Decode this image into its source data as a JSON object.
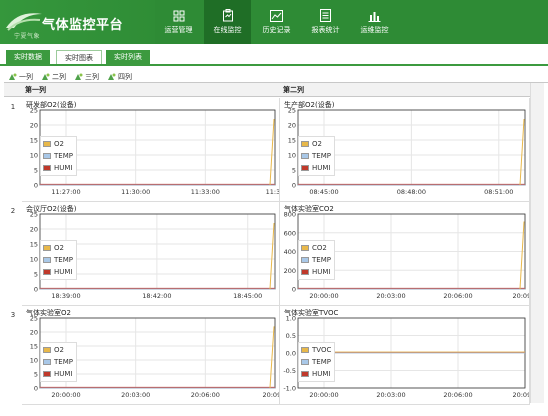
{
  "header": {
    "logo_sub": "宁夏气象",
    "title": "气体监控平台",
    "nav": [
      {
        "label": "运营管理",
        "icon": "grid-icon",
        "active": false
      },
      {
        "label": "在线监控",
        "icon": "monitor-clipboard-icon",
        "active": true
      },
      {
        "label": "历史记录",
        "icon": "line-chart-icon",
        "active": false
      },
      {
        "label": "报表统计",
        "icon": "report-doc-icon",
        "active": false
      },
      {
        "label": "运维监控",
        "icon": "bar-chart-icon",
        "active": false
      }
    ]
  },
  "tabs": [
    {
      "label": "实时数据",
      "active": false
    },
    {
      "label": "实时图表",
      "active": true
    },
    {
      "label": "实时列表",
      "active": false
    }
  ],
  "column_buttons": [
    "一列",
    "二列",
    "三列",
    "四列"
  ],
  "grid": {
    "col1_header": "第一列",
    "col2_header": "第二列",
    "rows": [
      "1",
      "2",
      "3"
    ]
  },
  "chart_data": [
    {
      "type": "line",
      "title": "研发部O2(设备)",
      "y_ticks": [
        "0",
        "5",
        "10",
        "15",
        "20",
        "25"
      ],
      "x_ticks": [
        "11:27:00",
        "11:30:00",
        "11:33:00",
        "11:36"
      ],
      "ylim": [
        0,
        25
      ],
      "series": [
        {
          "name": "O2",
          "color": "#e8b84a",
          "values_note_end": 22
        },
        {
          "name": "TEMP",
          "color": "#a9c8e8"
        },
        {
          "name": "HUMI",
          "color": "#c0392b"
        }
      ]
    },
    {
      "type": "line",
      "title": "生产部O2(设备)",
      "y_ticks": [
        "0",
        "5",
        "10",
        "15",
        "20",
        "25"
      ],
      "x_ticks": [
        "08:45:00",
        "08:48:00",
        "08:51:00"
      ],
      "ylim": [
        0,
        25
      ],
      "series": [
        {
          "name": "O2",
          "color": "#e8b84a",
          "values_note_end": 22
        },
        {
          "name": "TEMP",
          "color": "#a9c8e8"
        },
        {
          "name": "HUMI",
          "color": "#c0392b"
        }
      ]
    },
    {
      "type": "line",
      "title": "会议厅O2(设备)",
      "y_ticks": [
        "0",
        "5",
        "10",
        "15",
        "20",
        "25"
      ],
      "x_ticks": [
        "18:39:00",
        "18:42:00",
        "18:45:00"
      ],
      "ylim": [
        0,
        25
      ],
      "series": [
        {
          "name": "O2",
          "color": "#e8b84a",
          "values_note_end": 22
        },
        {
          "name": "TEMP",
          "color": "#a9c8e8"
        },
        {
          "name": "HUMI",
          "color": "#c0392b"
        }
      ]
    },
    {
      "type": "line",
      "title": "气体实验室CO2",
      "y_ticks": [
        "0",
        "200",
        "400",
        "600",
        "800"
      ],
      "x_ticks": [
        "20:00:00",
        "20:03:00",
        "20:06:00",
        "20:09:0"
      ],
      "ylim": [
        0,
        800
      ],
      "series": [
        {
          "name": "CO2",
          "color": "#e8b84a",
          "values_note_end": 720
        },
        {
          "name": "TEMP",
          "color": "#a9c8e8"
        },
        {
          "name": "HUMI",
          "color": "#c0392b"
        }
      ]
    },
    {
      "type": "line",
      "title": "气体实验室O2",
      "y_ticks": [
        "0",
        "5",
        "10",
        "15",
        "20",
        "25"
      ],
      "x_ticks": [
        "20:00:00",
        "20:03:00",
        "20:06:00",
        "20:09:0"
      ],
      "ylim": [
        0,
        25
      ],
      "series": [
        {
          "name": "O2",
          "color": "#e8b84a",
          "values_note_end": 22
        },
        {
          "name": "TEMP",
          "color": "#a9c8e8"
        },
        {
          "name": "HUMI",
          "color": "#c0392b"
        }
      ]
    },
    {
      "type": "line",
      "title": "气体实验室TVOC",
      "y_ticks": [
        "-1.0",
        "-0.5",
        "0.0",
        "0.5",
        "1.0"
      ],
      "x_ticks": [
        "20:00:00",
        "20:03:00",
        "20:06:00",
        "20:09:0"
      ],
      "ylim": [
        -1.0,
        1.0
      ],
      "series": [
        {
          "name": "TVOC",
          "color": "#e8b84a"
        },
        {
          "name": "TEMP",
          "color": "#a9c8e8"
        },
        {
          "name": "HUMI",
          "color": "#c0392b"
        }
      ]
    }
  ]
}
